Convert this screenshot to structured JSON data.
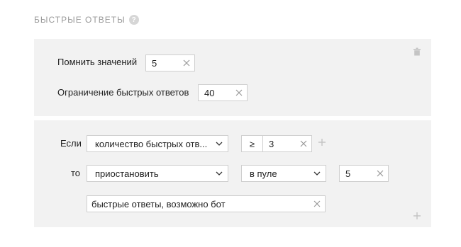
{
  "section": {
    "title": "БЫСТРЫЕ ОТВЕТЫ",
    "help_glyph": "?"
  },
  "settings": {
    "remember_label": "Помнить значений",
    "remember_value": "5",
    "limit_label": "Ограничение быстрых ответов",
    "limit_value": "40"
  },
  "rule": {
    "if_label": "Если",
    "condition_select": "количество быстрых отв...",
    "operator": "≥",
    "threshold_value": "3",
    "then_label": "то",
    "action_select": "приостановить",
    "scope_select": "в пуле",
    "scope_value": "5",
    "reason_value": "быстрые ответы, возможно бот"
  },
  "icons": {
    "trash": "trash-icon",
    "add_condition": "plus-icon",
    "add_rule": "plus-icon",
    "clear": "close-icon",
    "dropdown": "chevron-down-icon"
  }
}
